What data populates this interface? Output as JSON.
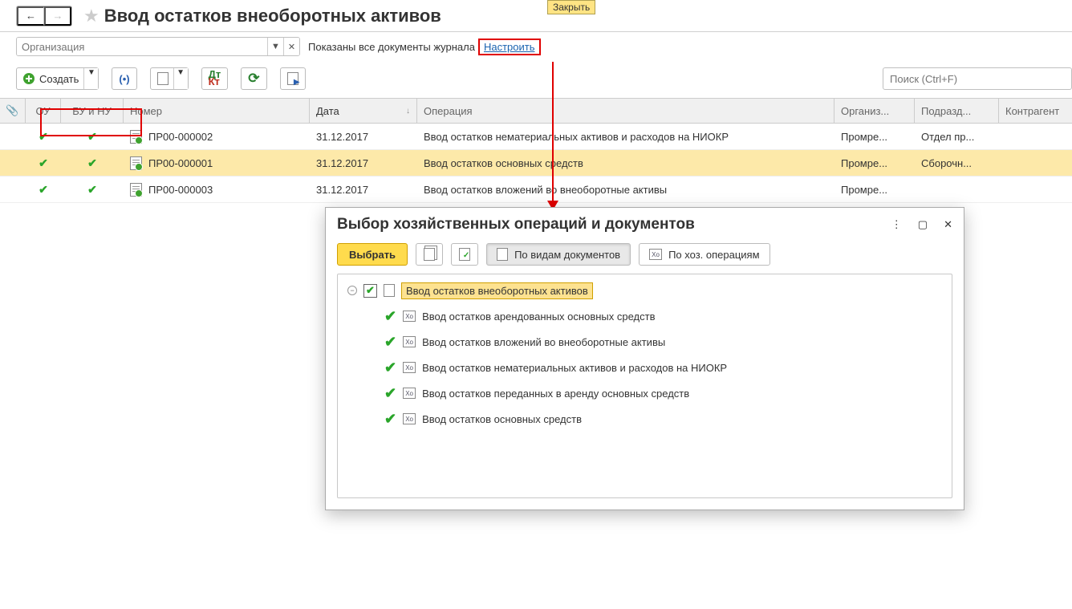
{
  "header": {
    "close_tooltip": "Закрыть",
    "title": "Ввод остатков внеоборотных активов"
  },
  "filter": {
    "org_placeholder": "Организация",
    "text": "Показаны все документы журнала",
    "link": "Настроить"
  },
  "toolbar": {
    "create_label": "Создать",
    "search_placeholder": "Поиск (Ctrl+F)"
  },
  "columns": {
    "ou": "ОУ",
    "bunu": "БУ и НУ",
    "nomer": "Номер",
    "date": "Дата",
    "op": "Операция",
    "org": "Организ...",
    "podr": "Подразд...",
    "ka": "Контрагент"
  },
  "rows": [
    {
      "nomer": "ПР00-000002",
      "date": "31.12.2017",
      "op": "Ввод остатков нематериальных активов и расходов на НИОКР",
      "org": "Промре...",
      "podr": "Отдел пр...",
      "selected": false
    },
    {
      "nomer": "ПР00-000001",
      "date": "31.12.2017",
      "op": "Ввод остатков основных средств",
      "org": "Промре...",
      "podr": "Сборочн...",
      "selected": true
    },
    {
      "nomer": "ПР00-000003",
      "date": "31.12.2017",
      "op": "Ввод остатков вложений во внеоборотные активы",
      "org": "Промре...",
      "podr": "",
      "selected": false
    }
  ],
  "popup": {
    "title": "Выбор хозяйственных операций и документов",
    "select_btn": "Выбрать",
    "by_docs": "По видам документов",
    "by_ops": "По хоз. операциям",
    "root": "Ввод остатков внеоборотных активов",
    "items": [
      "Ввод остатков арендованных основных средств",
      "Ввод остатков вложений во внеоборотные активы",
      "Ввод остатков нематериальных активов и расходов на НИОКР",
      "Ввод остатков переданных в аренду основных средств",
      "Ввод остатков основных средств"
    ]
  }
}
